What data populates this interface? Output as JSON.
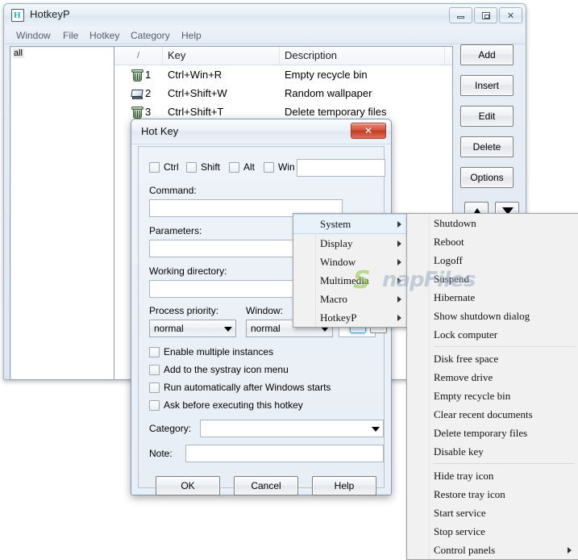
{
  "main_window": {
    "title": "HotkeyP",
    "icon": "app-icon",
    "titlebar_buttons": {
      "minimize": "minimize-icon",
      "maximize": "maximize-icon",
      "close": "✕"
    },
    "menubar": [
      "Window",
      "File",
      "Hotkey",
      "Category",
      "Help"
    ],
    "category_list": {
      "items": [
        "all"
      ]
    },
    "list_view": {
      "columns": [
        "/",
        "Key",
        "Description",
        ""
      ],
      "rows": [
        {
          "icon": "recycle-bin-icon",
          "num": "1",
          "key": "Ctrl+Win+R",
          "description": "Empty recycle bin"
        },
        {
          "icon": "monitor-icon",
          "num": "2",
          "key": "Ctrl+Shift+W",
          "description": "Random wallpaper"
        },
        {
          "icon": "recycle-bin-icon",
          "num": "3",
          "key": "Ctrl+Shift+T",
          "description": "Delete temporary files"
        }
      ]
    },
    "side_buttons": [
      "Add",
      "Insert",
      "Edit",
      "Delete",
      "Options"
    ],
    "move_buttons": {
      "up": "arrow-up-icon",
      "down": "arrow-down-icon"
    }
  },
  "dialog": {
    "title": "Hot Key",
    "close_label": "✕",
    "modifiers": [
      {
        "label": "Ctrl",
        "checked": false
      },
      {
        "label": "Shift",
        "checked": false
      },
      {
        "label": "Alt",
        "checked": false
      },
      {
        "label": "Win",
        "checked": false
      }
    ],
    "key_field_value": "",
    "command_label": "Command:",
    "command_value": "",
    "browse_prev_label": "<",
    "browse_dots_label": "...",
    "parameters_label": "Parameters:",
    "parameters_value": "",
    "working_dir_label": "Working directory:",
    "working_dir_value": "",
    "process_priority_label": "Process priority:",
    "process_priority_value": "normal",
    "window_label": "Window:",
    "window_value": "normal",
    "window_extra_value": "",
    "options": [
      {
        "label": "Enable multiple instances",
        "checked": false
      },
      {
        "label": "Add to the systray icon menu",
        "checked": false
      },
      {
        "label": "Run automatically after Windows starts",
        "checked": false
      },
      {
        "label": "Ask before executing this hotkey",
        "checked": false
      }
    ],
    "category_label": "Category:",
    "category_value": "",
    "note_label": "Note:",
    "note_value": "",
    "buttons": {
      "ok": "OK",
      "cancel": "Cancel",
      "help": "Help"
    }
  },
  "menu_level1": {
    "items": [
      {
        "label": "System",
        "submenu": true,
        "highlighted": true
      },
      {
        "label": "Display",
        "submenu": true,
        "highlighted": false
      },
      {
        "label": "Window",
        "submenu": true,
        "highlighted": false
      },
      {
        "label": "Multimedia",
        "submenu": true,
        "highlighted": false
      },
      {
        "label": "Macro",
        "submenu": true,
        "highlighted": false
      },
      {
        "label": "HotkeyP",
        "submenu": true,
        "highlighted": false
      }
    ]
  },
  "menu_level2": {
    "items": [
      {
        "label": "Shutdown",
        "submenu": false
      },
      {
        "label": "Reboot",
        "submenu": false
      },
      {
        "label": "Logoff",
        "submenu": false
      },
      {
        "label": "Suspend",
        "submenu": false
      },
      {
        "label": "Hibernate",
        "submenu": false
      },
      {
        "label": "Show shutdown dialog",
        "submenu": false
      },
      {
        "label": "Lock computer",
        "submenu": false
      },
      {
        "separator": true
      },
      {
        "label": "Disk free space",
        "submenu": false
      },
      {
        "label": "Remove drive",
        "submenu": false
      },
      {
        "label": "Empty recycle bin",
        "submenu": false
      },
      {
        "label": "Clear recent documents",
        "submenu": false
      },
      {
        "label": "Delete temporary files",
        "submenu": false
      },
      {
        "label": "Disable key",
        "submenu": false
      },
      {
        "separator": true
      },
      {
        "label": "Hide tray icon",
        "submenu": false
      },
      {
        "label": "Restore tray icon",
        "submenu": false
      },
      {
        "label": "Start service",
        "submenu": false
      },
      {
        "label": "Stop service",
        "submenu": false
      },
      {
        "label": "Control panels",
        "submenu": true
      }
    ]
  },
  "watermark": {
    "logo": "S",
    "text": "napFiles",
    "logo_color": "#8dc63f",
    "text_color": "#9bafc4"
  }
}
